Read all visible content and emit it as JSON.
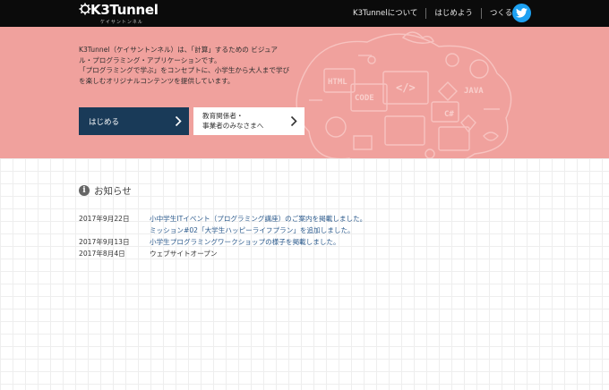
{
  "header": {
    "logo_text": "K3Tunnel",
    "logo_sub": "ケイサントンネル",
    "nav": [
      "K3Tunnelについて",
      "はじめよう",
      "つくる"
    ],
    "twitter_icon": "twitter-bird-icon"
  },
  "hero": {
    "lines": [
      "K3Tunnel（ケイサントンネル）は、「計算」するための ビジュア",
      "ル・プログラミング・アプリケーションです。",
      "「プログラミングで学ぶ」をコンセプトに、小学生から大人まで学び",
      "を楽しむオリジナルコンテンツを提供しています。"
    ],
    "btn_start": "はじめる",
    "btn_edu_line1": "教育関係者・",
    "btn_edu_line2": "事業者のみなさまへ",
    "art_labels": [
      "HTML",
      "CODE",
      "</>",
      "JAVA",
      "C#"
    ]
  },
  "news": {
    "title": "お知らせ",
    "items": [
      {
        "date": "2017年9月22日",
        "text": "小中学生ITイベント（プログラミング講座）のご案内を掲載しました。",
        "link": true
      },
      {
        "date": "",
        "text": "ミッション#02「大学生ハッピーライフプラン」を追加しました。",
        "link": true
      },
      {
        "date": "2017年9月13日",
        "text": "小学生プログラミングワークショップの様子を掲載しました。",
        "link": true
      },
      {
        "date": "2017年8月4日",
        "text": "ウェブサイトオープン",
        "link": false
      }
    ]
  },
  "colors": {
    "topbar": "#0b0b0b",
    "hero": "#f0a19d",
    "primary_button": "#193a58",
    "link": "#2b5a8c",
    "twitter": "#1da1f2"
  }
}
